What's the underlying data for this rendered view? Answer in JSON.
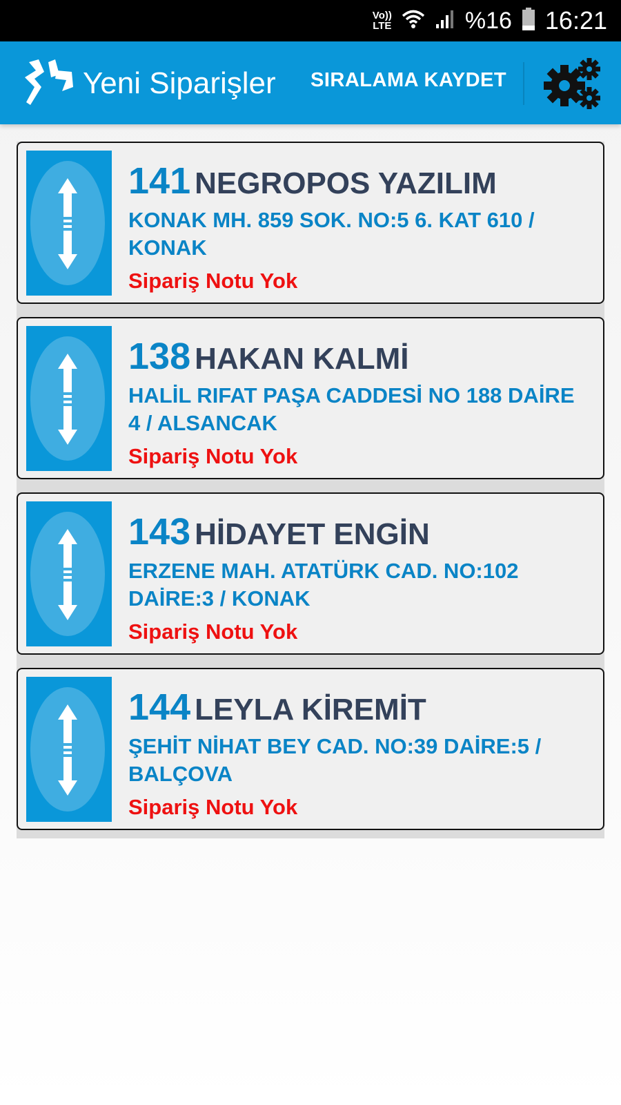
{
  "status_bar": {
    "network_top": "Vo))",
    "network_bottom": "LTE",
    "battery_percent": "%16",
    "time": "16:21"
  },
  "app_bar": {
    "title": "Yeni Siparişler",
    "save_order_label": "SIRALAMA KAYDET",
    "settings_icon": "gears-icon",
    "logo_icon": "app-logo",
    "background_color": "#0a97d9"
  },
  "orders": [
    {
      "number": "141",
      "name": "NEGROPOS YAZILIM",
      "address": "KONAK MH. 859 SOK. NO:5 6. KAT 610 / KONAK",
      "note": "Sipariş Notu Yok"
    },
    {
      "number": "138",
      "name": "HAKAN KALMİ",
      "address": "HALİL RIFAT PAŞA CADDESİ NO 188 DAİRE 4 / ALSANCAK",
      "note": "Sipariş Notu Yok"
    },
    {
      "number": "143",
      "name": "HİDAYET ENGİN",
      "address": "ERZENE MAH. ATATÜRK CAD. NO:102 DAİRE:3 / KONAK",
      "note": "Sipariş Notu Yok"
    },
    {
      "number": "144",
      "name": "LEYLA KİREMİT",
      "address": "ŞEHİT NİHAT BEY CAD. NO:39 DAİRE:5 / BALÇOVA",
      "note": "Sipariş Notu Yok"
    }
  ],
  "colors": {
    "number_blue": "#0a84c6",
    "name_dark": "#33415a",
    "note_red": "#ee1111"
  }
}
